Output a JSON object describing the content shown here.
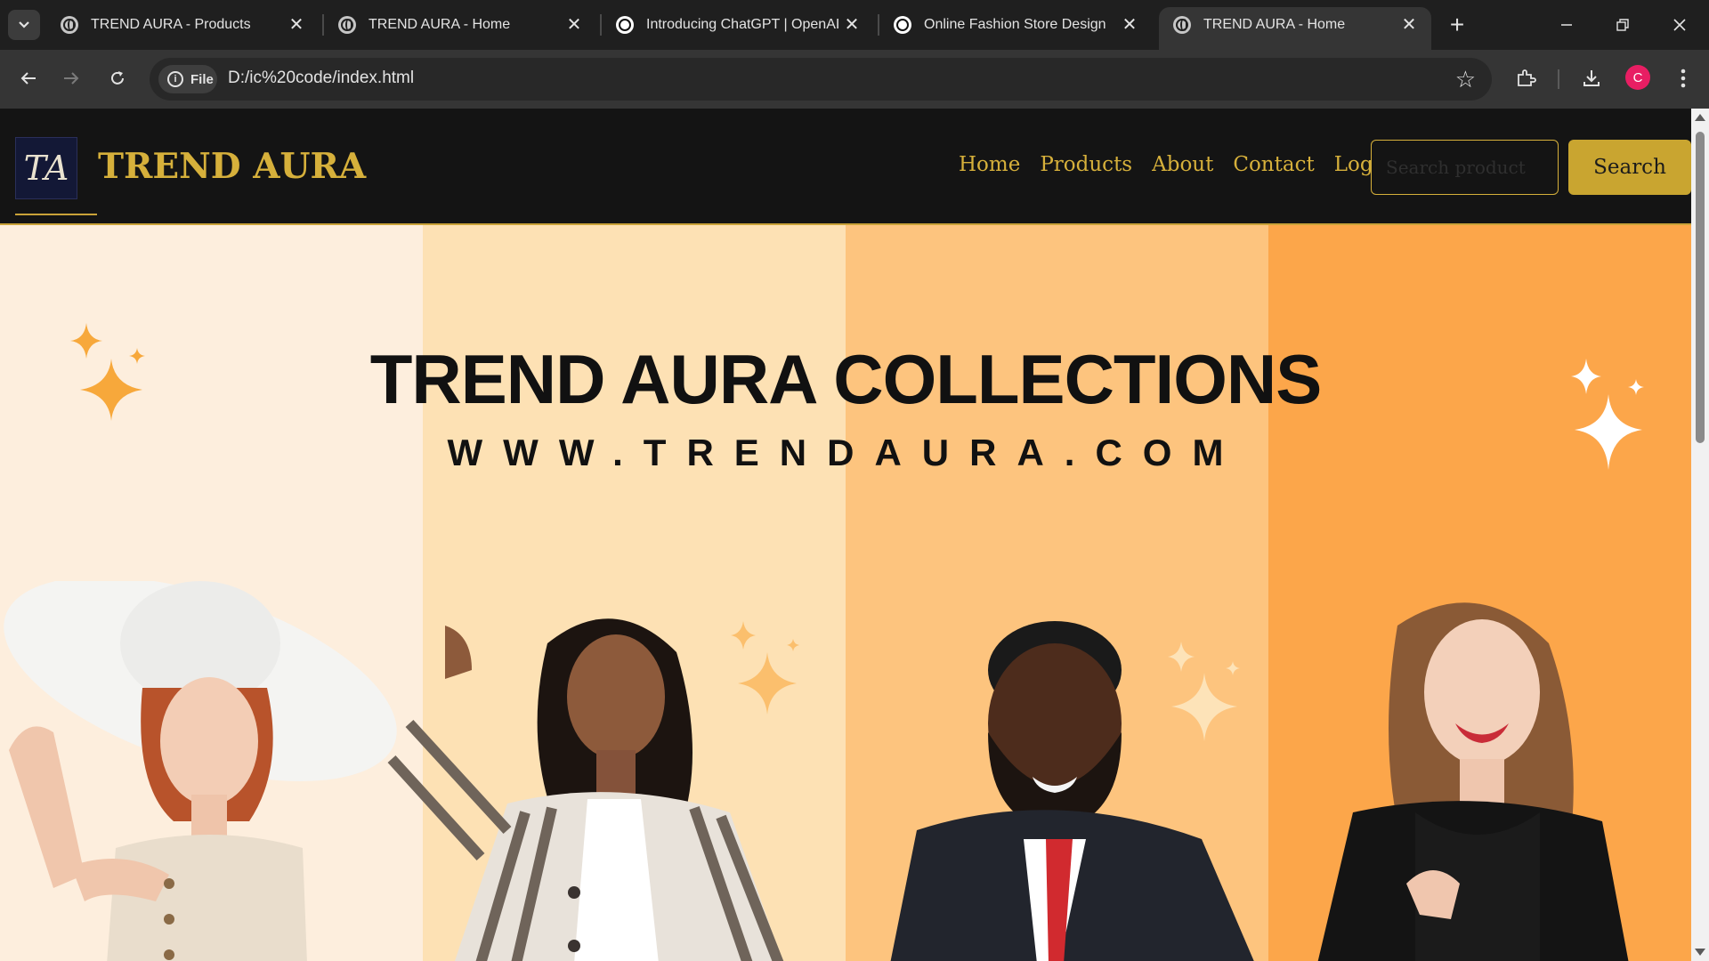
{
  "browser": {
    "tabs": [
      {
        "title": "TREND AURA - Products",
        "favicon": "globe-icon"
      },
      {
        "title": "TREND AURA - Home",
        "favicon": "globe-icon"
      },
      {
        "title": "Introducing ChatGPT | OpenAI",
        "favicon": "openai-icon"
      },
      {
        "title": "Online Fashion Store Design",
        "favicon": "openai-icon"
      },
      {
        "title": "TREND AURA - Home",
        "favicon": "globe-icon",
        "active": true
      }
    ],
    "close_glyph": "✕",
    "new_tab_glyph": "+",
    "site_chip_label": "File",
    "url": "D:/ic%20code/index.html",
    "avatar_letter": "C"
  },
  "site": {
    "brand": "TREND AURA",
    "logo_text": "TA",
    "nav": [
      "Home",
      "Products",
      "About",
      "Contact",
      "Login"
    ],
    "search_placeholder": "Search product",
    "search_button": "Search"
  },
  "hero": {
    "title": "TREND AURA COLLECTIONS",
    "url": "WWW.TRENDAURA.COM"
  },
  "colors": {
    "header_bg": "#141414",
    "gold": "#d6b03b",
    "stripes": [
      "#fdeedd",
      "#fde1b4",
      "#fdc47e",
      "#fca64a"
    ],
    "sparkle": "#f7a83b"
  }
}
